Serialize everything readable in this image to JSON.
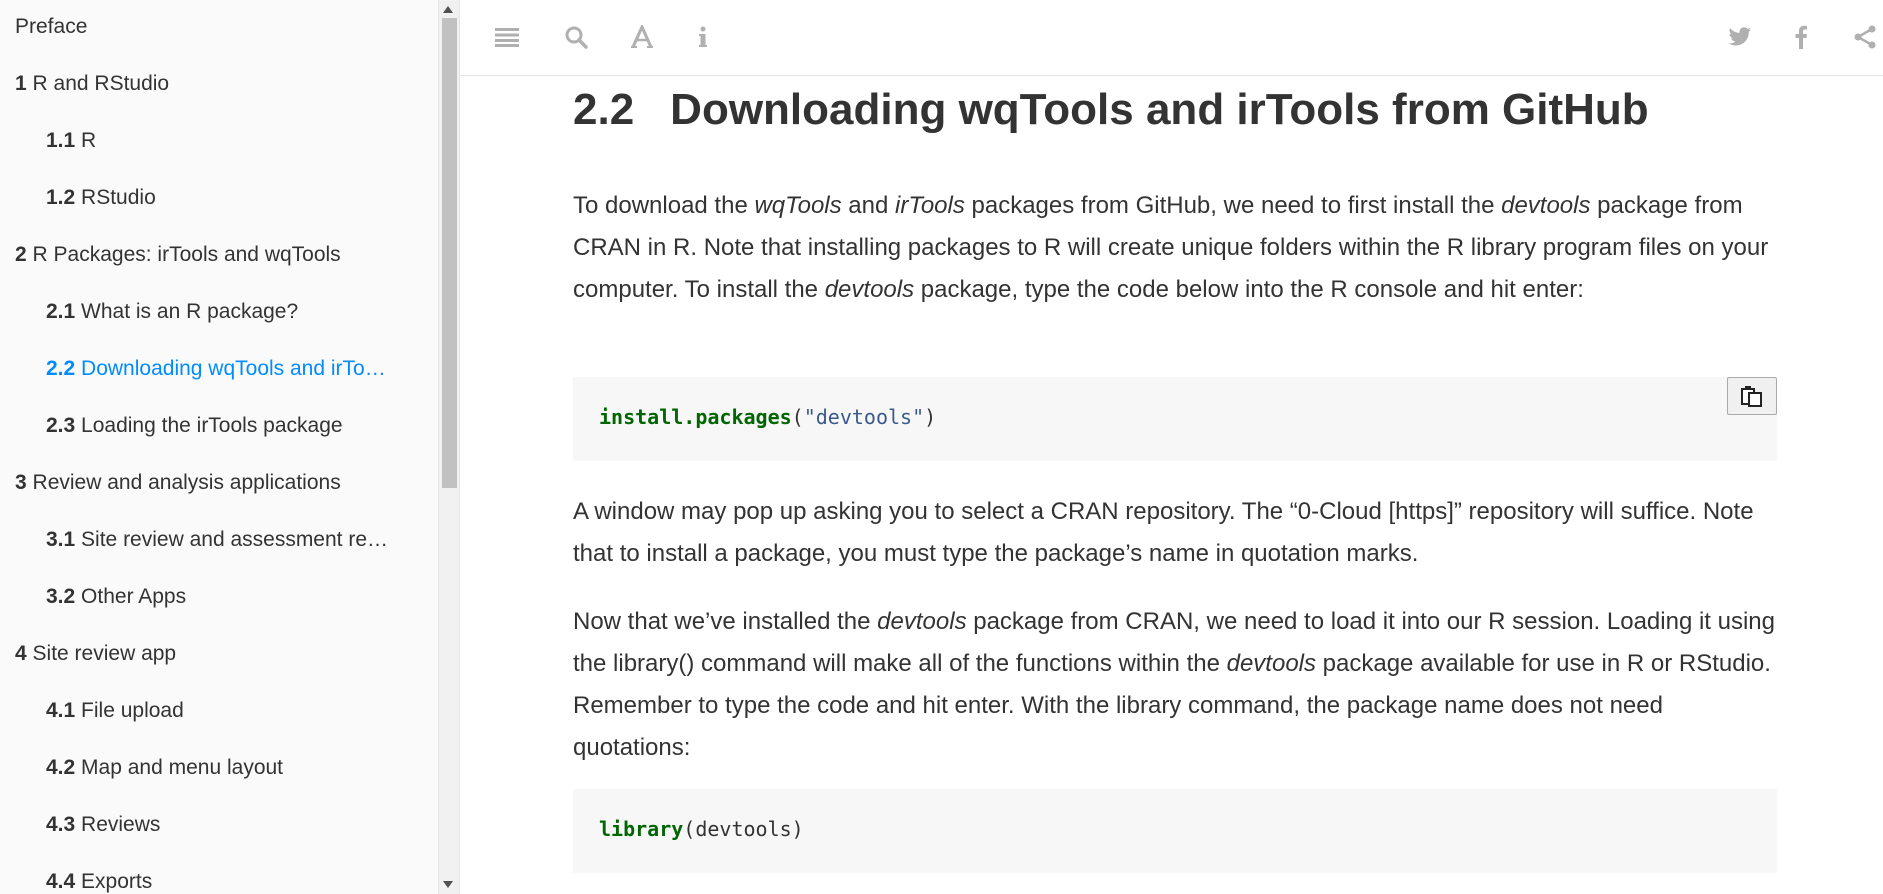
{
  "toc": [
    {
      "num": "",
      "label": "Preface",
      "level": 0
    },
    {
      "num": "1",
      "label": "R and RStudio",
      "level": 0
    },
    {
      "num": "1.1",
      "label": "R",
      "level": 1
    },
    {
      "num": "1.2",
      "label": "RStudio",
      "level": 1
    },
    {
      "num": "2",
      "label": "R Packages: irTools and wqTools",
      "level": 0
    },
    {
      "num": "2.1",
      "label": "What is an R package?",
      "level": 1
    },
    {
      "num": "2.2",
      "label": "Downloading wqTools and irTo…",
      "level": 1,
      "active": true
    },
    {
      "num": "2.3",
      "label": "Loading the irTools package",
      "level": 1
    },
    {
      "num": "3",
      "label": "Review and analysis applications",
      "level": 0
    },
    {
      "num": "3.1",
      "label": "Site review and assessment re…",
      "level": 1
    },
    {
      "num": "3.2",
      "label": "Other Apps",
      "level": 1
    },
    {
      "num": "4",
      "label": "Site review app",
      "level": 0
    },
    {
      "num": "4.1",
      "label": "File upload",
      "level": 1
    },
    {
      "num": "4.2",
      "label": "Map and menu layout",
      "level": 1
    },
    {
      "num": "4.3",
      "label": "Reviews",
      "level": 1
    },
    {
      "num": "4.4",
      "label": "Exports",
      "level": 1
    }
  ],
  "toolbar": {
    "left_icons": [
      "menu-icon",
      "search-icon",
      "font-icon",
      "info-icon"
    ],
    "right_icons": [
      "twitter-icon",
      "facebook-icon",
      "share-icon"
    ]
  },
  "section": {
    "number": "2.2",
    "title": "Downloading wqTools and irTools from GitHub"
  },
  "para1": {
    "a": "To download the ",
    "b": "wqTools",
    "c": " and ",
    "d": "irTools",
    "e": " packages from GitHub, we need to first install the ",
    "f": "devtools",
    "g": " package from CRAN in R. Note that installing packages to R will create unique folders within the R library program files on your computer. To install the ",
    "h": "devtools",
    "i": " package, type the code below into the R console and hit enter:"
  },
  "code1": {
    "fn": "install.packages",
    "open": "(",
    "str": "\"devtools\"",
    "close": ")"
  },
  "para2": "A window may pop up asking you to select a CRAN repository. The “0-Cloud [https]” repository will suffice. Note that to install a package, you must type the package’s name in quotation marks.",
  "para3": {
    "a": "Now that we’ve installed the ",
    "b": "devtools",
    "c": " package from CRAN, we need to load it into our R session. Loading it using the library() command will make all of the functions within the ",
    "d": "devtools",
    "e": " package available for use in R or RStudio. Remember to type the code and hit enter. With the library command, the package name does not need quotations:"
  },
  "code2": {
    "fn": "library",
    "rest": "(devtools)"
  },
  "colors": {
    "accent": "#008cff",
    "text": "#333333",
    "code_bg": "#f7f7f7",
    "sidebar_bg": "#fafafa"
  }
}
